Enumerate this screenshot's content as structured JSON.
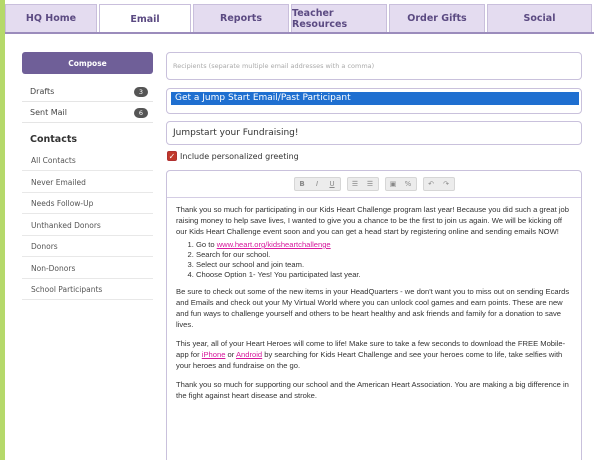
{
  "nav": {
    "tabs": [
      {
        "label": "HQ Home"
      },
      {
        "label": "Email"
      },
      {
        "label": "Reports"
      },
      {
        "label": "Teacher Resources"
      },
      {
        "label": "Order Gifts"
      },
      {
        "label": "Social"
      }
    ],
    "active_tab": "Email"
  },
  "sidebar": {
    "compose_label": "Compose",
    "folders": [
      {
        "label": "Drafts",
        "count": "3"
      },
      {
        "label": "Sent Mail",
        "count": "6"
      }
    ],
    "contacts_heading": "Contacts",
    "contacts": [
      "All Contacts",
      "Never Emailed",
      "Needs Follow-Up",
      "Unthanked Donors",
      "Donors",
      "Non-Donors",
      "School Participants"
    ]
  },
  "compose": {
    "recipients_placeholder": "Recipients (separate multiple email addresses with a comma)",
    "subject_selected": "Get a Jump Start Email/Past Participant",
    "headline": "Jumpstart your Fundraising!",
    "include_greeting_label": "Include personalized greeting",
    "include_greeting_checked": true
  },
  "toolbar": {
    "bold": "B",
    "italic": "I",
    "underline": "U",
    "ordered_list": "☰",
    "unordered_list": "☰",
    "image": "▣",
    "link": "%",
    "undo": "↶",
    "redo": "↷"
  },
  "message": {
    "para1": "Thank you so much for participating in our Kids Heart Challenge program last year! Because you did such a great job raising money to help save lives, I wanted to give you a chance to be the first to join us again. We will be kicking off our Kids Heart Challenge event soon and you can get a head start by registering online and sending emails NOW!",
    "step1_prefix": "Go to ",
    "step1_link": "www.heart.org/kidsheartchallenge",
    "step2": "Search for our school.",
    "step3": "Select our school and join team.",
    "step4": "Choose Option 1- Yes! You participated  last year.",
    "para2": "Be sure to check out some of the new items in your HeadQuarters - we don't want you to miss out on sending Ecards and Emails and check out your My Virtual World where you can unlock cool games and earn points. These are new and fun ways to challenge yourself and others to be heart healthy and ask friends and family for a donation to save lives.",
    "para3_a": "This year, all of your Heart Heroes will come to life! Make sure to take a few seconds to download the FREE Mobile-app for ",
    "para3_link1": "iPhone",
    "para3_b": " or ",
    "para3_link2": "Android",
    "para3_c": " by searching for Kids Heart Challenge and see your heroes come to life, take selfies with your heroes and fundraise on the go.",
    "para4": "Thank you so much for supporting our school and the American Heart Association. You are making a big difference in the fight against heart disease and stroke."
  },
  "colors": {
    "accent": "#6f5f98",
    "tab_bg": "#e4dcf0",
    "link": "#d6189c",
    "selection": "#1f6fd0",
    "left_stripe": "#b5d96a"
  }
}
